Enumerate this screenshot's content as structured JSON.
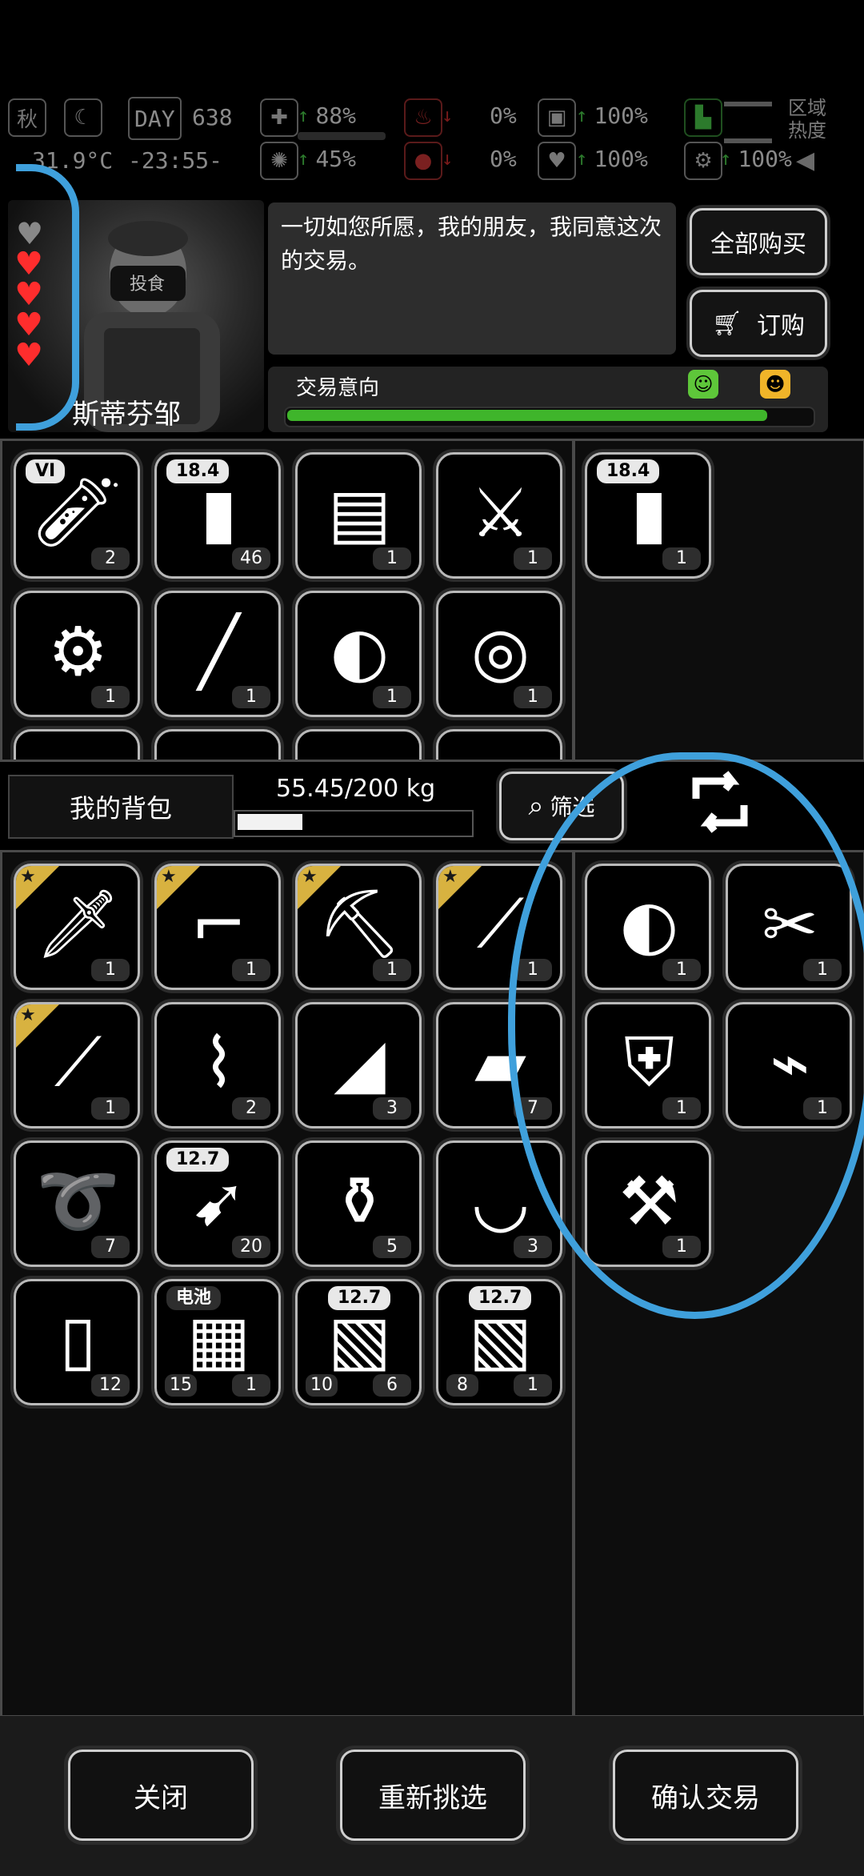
{
  "status": {
    "season": "秋",
    "temperature": "31.9°C",
    "day_label": "DAY",
    "day_value": "638",
    "time": "-23:55-",
    "stats": [
      {
        "name": "health",
        "top": "88%",
        "bottom": "45%"
      },
      {
        "name": "blood",
        "top": "0%",
        "bottom": "0%"
      },
      {
        "name": "stamina",
        "top": "100%",
        "bottom": "100%"
      },
      {
        "name": "radiation",
        "top": "100%",
        "bottom": ""
      }
    ],
    "zone_label": "区域\n热度"
  },
  "trader": {
    "name": "斯蒂芬邹",
    "dialogue": "一切如您所愿，我的朋友，我同意这次的交易。",
    "hearts": {
      "filled": 4,
      "empty": 1
    },
    "buy_all_label": "全部购买",
    "order_label": "订购",
    "intent_label": "交易意向",
    "intent_level": 0.92
  },
  "trader_inventory": [
    {
      "icon": "vial-icon",
      "tag": "VI",
      "count": "2"
    },
    {
      "icon": "shotgun-shell-icon",
      "tag": "18.4",
      "count": "46"
    },
    {
      "icon": "document-icon",
      "tag": "",
      "count": "1"
    },
    {
      "icon": "claw-blade-icon",
      "tag": "",
      "count": "1"
    },
    {
      "icon": "engine-icon",
      "tag": "",
      "count": "1"
    },
    {
      "icon": "rod-icon",
      "tag": "",
      "count": "1"
    },
    {
      "icon": "helmet-icon",
      "tag": "",
      "count": "1"
    },
    {
      "icon": "duct-tape-icon",
      "tag": "",
      "count": "1"
    }
  ],
  "trader_offer": [
    {
      "icon": "shotgun-shell-icon",
      "tag": "18.4",
      "count": "1"
    }
  ],
  "bag": {
    "label": "我的背包",
    "weight": "55.45/200 kg",
    "weight_fraction": 0.28,
    "filter_label": "筛选"
  },
  "player_inventory": [
    {
      "icon": "machete-icon",
      "tag": "",
      "count": "1",
      "starred": true
    },
    {
      "icon": "rifle-icon",
      "tag": "",
      "count": "1",
      "starred": true
    },
    {
      "icon": "shovel-icon",
      "tag": "",
      "count": "1",
      "starred": true
    },
    {
      "icon": "katana-icon",
      "tag": "",
      "count": "1",
      "starred": true
    },
    {
      "icon": "katana-icon",
      "tag": "",
      "count": "1",
      "starred": true
    },
    {
      "icon": "bandage-icon",
      "tag": "",
      "count": "2",
      "starred": false
    },
    {
      "icon": "cloth-icon",
      "tag": "",
      "count": "3",
      "starred": false
    },
    {
      "icon": "leather-icon",
      "tag": "",
      "count": "7",
      "starred": false
    },
    {
      "icon": "rope-icon",
      "tag": "",
      "count": "7",
      "starred": false
    },
    {
      "icon": "bullet-icon",
      "tag": "12.7",
      "count": "20",
      "starred": false
    },
    {
      "icon": "bottles-icon",
      "tag": "",
      "count": "5",
      "starred": false
    },
    {
      "icon": "bowl-icon",
      "tag": "",
      "count": "3",
      "starred": false
    },
    {
      "icon": "bottle-icon",
      "tag": "",
      "count": "12",
      "starred": false
    },
    {
      "icon": "battery-pack-icon",
      "tag": "电池",
      "count": "1",
      "sub": "15",
      "starred": false
    },
    {
      "icon": "ammo-box-icon",
      "tag": "12.7",
      "count": "6",
      "sub": "10",
      "starred": false
    },
    {
      "icon": "ammo-box-icon",
      "tag": "12.7",
      "count": "1",
      "sub": "8",
      "starred": false
    }
  ],
  "player_offer": [
    {
      "icon": "helmet-icon",
      "tag": "",
      "count": "1"
    },
    {
      "icon": "parts-icon",
      "tag": "",
      "count": "1"
    },
    {
      "icon": "armor-vest-icon",
      "tag": "",
      "count": "1"
    },
    {
      "icon": "energy-gun-icon",
      "tag": "",
      "count": "1"
    },
    {
      "icon": "sledgehammer-icon",
      "tag": "",
      "count": "1"
    }
  ],
  "actions": {
    "close": "关闭",
    "reselect": "重新挑选",
    "confirm": "确认交易"
  },
  "colors": {
    "accent_blue": "#3fa0dc",
    "heart_red": "#ff2d2d",
    "intent_green": "#3fb52b",
    "star_gold": "#d8b240"
  }
}
